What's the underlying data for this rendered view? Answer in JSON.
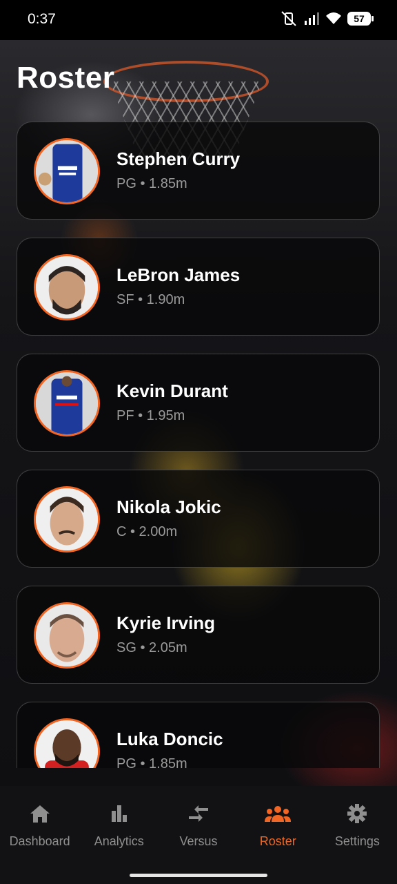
{
  "status_bar": {
    "time": "0:37",
    "battery": "57"
  },
  "page": {
    "title": "Roster"
  },
  "players": [
    {
      "name": "Stephen Curry",
      "meta": "PG • 1.85m"
    },
    {
      "name": "LeBron James",
      "meta": "SF • 1.90m"
    },
    {
      "name": "Kevin Durant",
      "meta": "PF • 1.95m"
    },
    {
      "name": "Nikola Jokic",
      "meta": "C • 2.00m"
    },
    {
      "name": "Kyrie Irving",
      "meta": "SG • 2.05m"
    },
    {
      "name": "Luka Doncic",
      "meta": "PG • 1.85m"
    }
  ],
  "nav": [
    {
      "label": "Dashboard",
      "icon": "home-icon"
    },
    {
      "label": "Analytics",
      "icon": "bar-chart-icon"
    },
    {
      "label": "Versus",
      "icon": "compare-arrows-icon"
    },
    {
      "label": "Roster",
      "icon": "group-icon"
    },
    {
      "label": "Settings",
      "icon": "gear-icon"
    }
  ],
  "colors": {
    "accent": "#f26522",
    "inactive": "#8f8f8f",
    "nav_bg": "#121214"
  }
}
